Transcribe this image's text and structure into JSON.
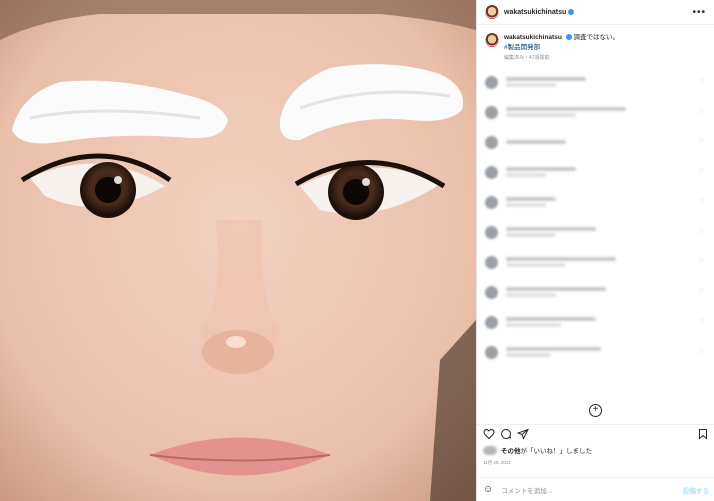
{
  "post": {
    "username": "wakatsukichinatsu",
    "caption": "調査ではない。",
    "hashtag": "#製品開発部",
    "caption_meta": "編集済み・47週間前",
    "likes_prefix": "その他",
    "likes_mid": "が「いいね！」しました",
    "likes_quoted": "「いいね！」",
    "date": "11月 20, 2021",
    "comment_placeholder": "コメントを追加...",
    "post_button": "投稿する"
  },
  "icons": {
    "more": "more-horizontal-icon",
    "like": "heart-icon",
    "comment": "comment-icon",
    "share": "paper-plane-icon",
    "save": "bookmark-icon",
    "load_more": "plus-circle-icon",
    "emoji": "smiley-icon"
  },
  "comment_count": 10,
  "colors": {
    "link": "#00376b",
    "verified": "#3897f0",
    "post_button": "#b2dffc"
  }
}
